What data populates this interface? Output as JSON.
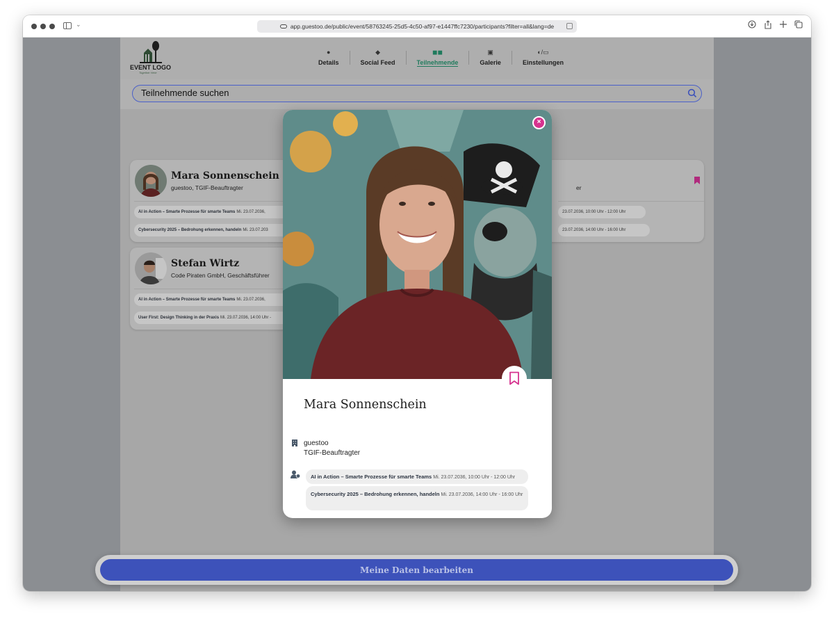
{
  "browser": {
    "url": "app.guestoo.de/public/event/58763245-25d5-4c50-af97-e1447ffc7230/participants?filter=all&lang=de"
  },
  "header": {
    "logo_text": "EVENT LOGO",
    "logo_tagline": "Together Here",
    "nav": [
      {
        "label": "Details",
        "icon": "info-icon"
      },
      {
        "label": "Social Feed",
        "icon": "chat-icon"
      },
      {
        "label": "Teilnehmende",
        "icon": "people-icon",
        "active": true
      },
      {
        "label": "Galerie",
        "icon": "image-icon"
      },
      {
        "label": "Einstellungen",
        "icon": "contrast-icon"
      }
    ]
  },
  "search": {
    "placeholder": "Teilnehmende suchen"
  },
  "participants": [
    {
      "name": "Mara Sonnenschein",
      "subtitle": "guestoo, TGIF-Beauftragter",
      "sessions": [
        {
          "title": "AI in Action – Smarte Prozesse für smarte Teams",
          "time": "Mi. 23.07.2036,"
        },
        {
          "title": "Cybersecurity 2025 – Bedrohung erkennen, handeln",
          "time": "Mi. 23.07.203"
        }
      ]
    },
    {
      "name": "Stefan Wirtz",
      "subtitle": "Code Piraten GmbH, Geschäftsführer",
      "sessions": [
        {
          "title": "AI in Action – Smarte Prozesse für smarte Teams",
          "time": "Mi. 23.07.2036,"
        },
        {
          "title": "User First: Design Thinking in der Praxis",
          "time": "Mi. 23.07.2036, 14:00 Uhr -"
        }
      ]
    },
    {
      "subtitle_tail": "er",
      "sessions": [
        {
          "time": "23.07.2036, 10:00 Uhr - 12:00 Uhr"
        },
        {
          "time": "23.07.2036, 14:00 Uhr - 16:00 Uhr"
        }
      ]
    }
  ],
  "modal": {
    "name": "Mara Sonnenschein",
    "company": "guestoo",
    "role": "TGIF-Beauftragter",
    "close_label": "×",
    "sessions": [
      {
        "title": "AI in Action – Smarte Prozesse für smarte Teams",
        "time": "Mi. 23.07.2036, 10:00 Uhr - 12:00 Uhr"
      },
      {
        "title": "Cybersecurity 2025 – Bedrohung erkennen, handeln",
        "time": "Mi. 23.07.2036, 14:00 Uhr - 16:00 Uhr"
      }
    ]
  },
  "cta": {
    "label": "Meine Daten bearbeiten"
  },
  "colors": {
    "accent": "#3d52ba",
    "active_nav": "#1f7a5c",
    "bookmark": "#d6338f"
  }
}
